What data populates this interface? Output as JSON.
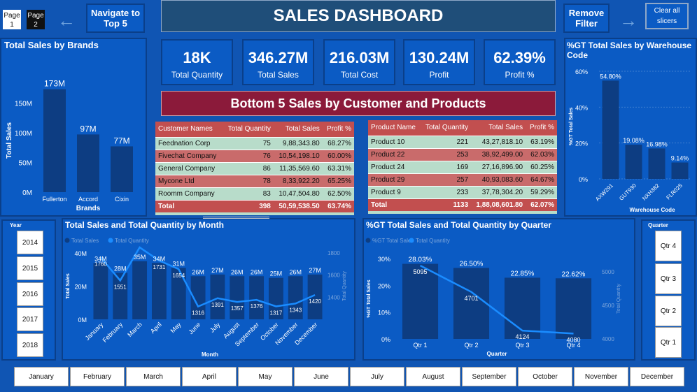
{
  "nav": {
    "page1": "Page 1",
    "page2": "Page 2",
    "navigate_label": "Navigate to Top 5",
    "title": "SALES DASHBOARD",
    "remove_filter": "Remove Filter",
    "clear_slicers": "Clear all slicers",
    "back_arrow": "←",
    "forward_arrow": "→"
  },
  "kpis": [
    {
      "value": "18K",
      "label": "Total Quantity"
    },
    {
      "value": "346.27M",
      "label": "Total Sales"
    },
    {
      "value": "216.03M",
      "label": "Total Cost"
    },
    {
      "value": "130.24M",
      "label": "Profit"
    },
    {
      "value": "62.39%",
      "label": "Profit %"
    }
  ],
  "banner": "Bottom 5 Sales by Customer and Products",
  "customer_table": {
    "headers": [
      "Customer Names",
      "Total Quantity",
      "Total Sales",
      "Profit %"
    ],
    "rows": [
      [
        "Feednation Corp",
        "75",
        "9,88,343.80",
        "68.27%"
      ],
      [
        "Fivechat Company",
        "76",
        "10,54,198.10",
        "60.00%"
      ],
      [
        "General Company",
        "86",
        "11,35,569.60",
        "63.31%"
      ],
      [
        "Mycone Ltd",
        "78",
        "8,33,922.20",
        "65.25%"
      ],
      [
        "Roomm Company",
        "83",
        "10,47,504.80",
        "62.50%"
      ]
    ],
    "total": [
      "Total",
      "398",
      "50,59,538.50",
      "63.74%"
    ]
  },
  "product_table": {
    "headers": [
      "Product Name",
      "Total Quantity",
      "Total Sales",
      "Profit %"
    ],
    "rows": [
      [
        "Product 10",
        "221",
        "43,27,818.10",
        "63.19%"
      ],
      [
        "Product 22",
        "253",
        "38,92,499.00",
        "62.03%"
      ],
      [
        "Product 24",
        "169",
        "27,16,896.90",
        "60.25%"
      ],
      [
        "Product 29",
        "257",
        "40,93,083.60",
        "64.67%"
      ],
      [
        "Product 9",
        "233",
        "37,78,304.20",
        "59.29%"
      ]
    ],
    "total": [
      "Total",
      "1133",
      "1,88,08,601.80",
      "62.07%"
    ]
  },
  "year_slicer": {
    "title": "Year",
    "items": [
      "2014",
      "2015",
      "2016",
      "2017",
      "2018"
    ]
  },
  "quarter_slicer": {
    "title": "Quarter",
    "items": [
      "Qtr 4",
      "Qtr 3",
      "Qtr 2",
      "Qtr 1"
    ]
  },
  "month_slicer": [
    "January",
    "February",
    "March",
    "April",
    "May",
    "June",
    "July",
    "August",
    "September",
    "October",
    "November",
    "December"
  ],
  "colors": {
    "bar": "#0d3d82",
    "line": "#1a8cff",
    "bg": "#0b5bc4",
    "red": "#c24f4f",
    "green": "#b8dcca",
    "banner": "#8b1a3a"
  },
  "chart_data": [
    {
      "type": "bar",
      "title": "Total Sales by Brands",
      "xlabel": "Brands",
      "ylabel": "Total Sales",
      "categories": [
        "Fullerton",
        "Accord",
        "Cixin"
      ],
      "values": [
        173,
        97,
        77
      ],
      "data_labels": [
        "173M",
        "97M",
        "77M"
      ],
      "yticks": [
        "0M",
        "50M",
        "100M",
        "150M"
      ],
      "ylim": [
        0,
        175
      ]
    },
    {
      "type": "bar",
      "title": "%GT Total Sales by Warehouse Code",
      "xlabel": "Warehouse Code",
      "ylabel": "%GT Total Sales",
      "categories": [
        "AXW291",
        "GUT930",
        "NXH382",
        "FLR025"
      ],
      "values": [
        54.8,
        19.08,
        16.98,
        9.14
      ],
      "data_labels": [
        "54.80%",
        "19.08%",
        "16.98%",
        "9.14%"
      ],
      "yticks": [
        "0%",
        "20%",
        "40%",
        "60%"
      ],
      "ylim": [
        0,
        60
      ]
    },
    {
      "type": "bar",
      "title": "Total Sales and Total Quantity by Month",
      "xlabel": "Month",
      "ylabel": "Total Sales",
      "y2label": "Total Quantity",
      "legend": [
        "Total Sales",
        "Total Quantity"
      ],
      "categories": [
        "January",
        "February",
        "March",
        "April",
        "May",
        "June",
        "July",
        "August",
        "September",
        "October",
        "November",
        "December"
      ],
      "series": [
        {
          "name": "Total Sales",
          "values": [
            34,
            28,
            35,
            34,
            31,
            26,
            27,
            26,
            26,
            25,
            26,
            27
          ],
          "labels": [
            "34M",
            "28M",
            "35M",
            "34M",
            "31M",
            "26M",
            "27M",
            "26M",
            "26M",
            "25M",
            "26M",
            "27M"
          ]
        },
        {
          "name": "Total Quantity",
          "values": [
            1760,
            1551,
            1850,
            1731,
            1654,
            1316,
            1391,
            1357,
            1376,
            1317,
            1343,
            1420
          ],
          "labels": [
            "1760",
            "1551",
            "",
            "1731",
            "1654",
            "1316",
            "1391",
            "1357",
            "1376",
            "1317",
            "1343",
            "1420"
          ]
        }
      ],
      "yticks": [
        "0M",
        "20M",
        "40M"
      ],
      "y2ticks": [
        "1400",
        "1600",
        "1800"
      ],
      "ylim": [
        0,
        40
      ],
      "y2lim": [
        1200,
        1800
      ]
    },
    {
      "type": "bar",
      "title": "%GT Total Sales and Total Quantity by Quarter",
      "xlabel": "Quarter",
      "ylabel": "%GT Total Sales",
      "y2label": "Total Quantity",
      "legend": [
        "%GT Total Sales",
        "Total Quantity"
      ],
      "categories": [
        "Qtr 1",
        "Qtr 2",
        "Qtr 3",
        "Qtr 4"
      ],
      "series": [
        {
          "name": "%GT Total Sales",
          "values": [
            28.03,
            26.5,
            22.85,
            22.62
          ],
          "labels": [
            "28.03%",
            "26.50%",
            "22.85%",
            "22.62%"
          ]
        },
        {
          "name": "Total Quantity",
          "values": [
            5095,
            4701,
            4124,
            4080
          ],
          "labels": [
            "5095",
            "4701",
            "4124",
            "4080"
          ]
        }
      ],
      "yticks": [
        "0%",
        "10%",
        "20%",
        "30%"
      ],
      "y2ticks": [
        "4000",
        "4500",
        "5000"
      ],
      "ylim": [
        0,
        30
      ],
      "y2lim": [
        4000,
        5200
      ]
    }
  ]
}
